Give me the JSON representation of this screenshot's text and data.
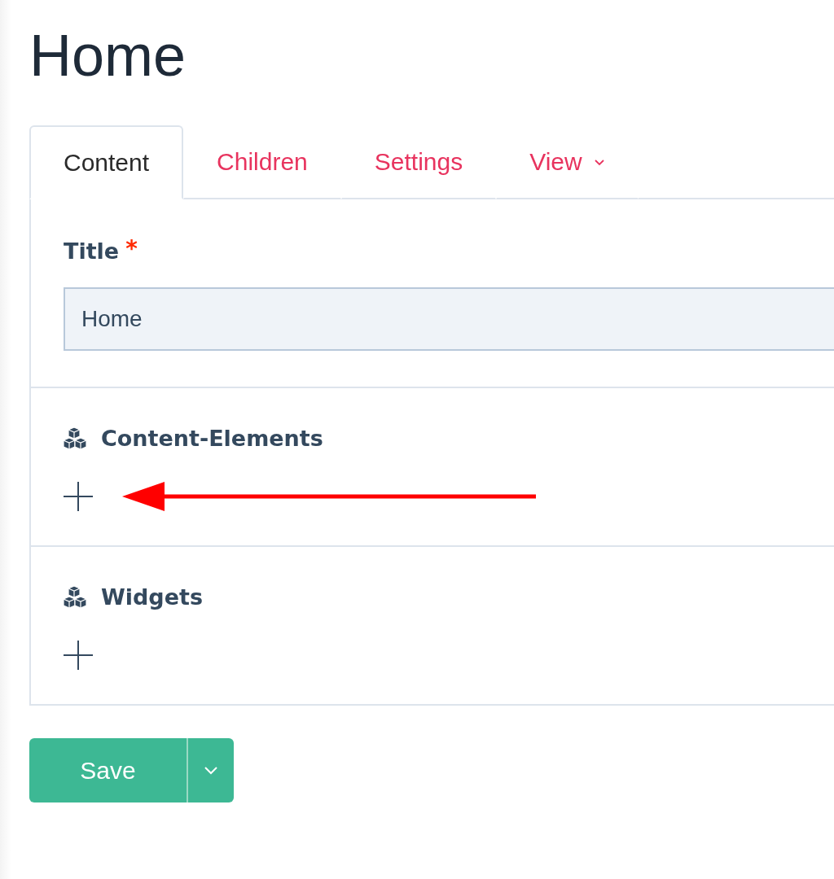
{
  "page_title": "Home",
  "tabs": [
    {
      "label": "Content",
      "selected": true,
      "has_menu": false
    },
    {
      "label": "Children",
      "selected": false,
      "has_menu": false
    },
    {
      "label": "Settings",
      "selected": false,
      "has_menu": false
    },
    {
      "label": "View",
      "selected": false,
      "has_menu": true
    }
  ],
  "title_field": {
    "label": "Title",
    "required_mark": "*",
    "value": "Home"
  },
  "sections": [
    {
      "title": "Content-Elements",
      "annotated": true
    },
    {
      "title": "Widgets",
      "annotated": false
    }
  ],
  "save_button": {
    "label": "Save"
  }
}
